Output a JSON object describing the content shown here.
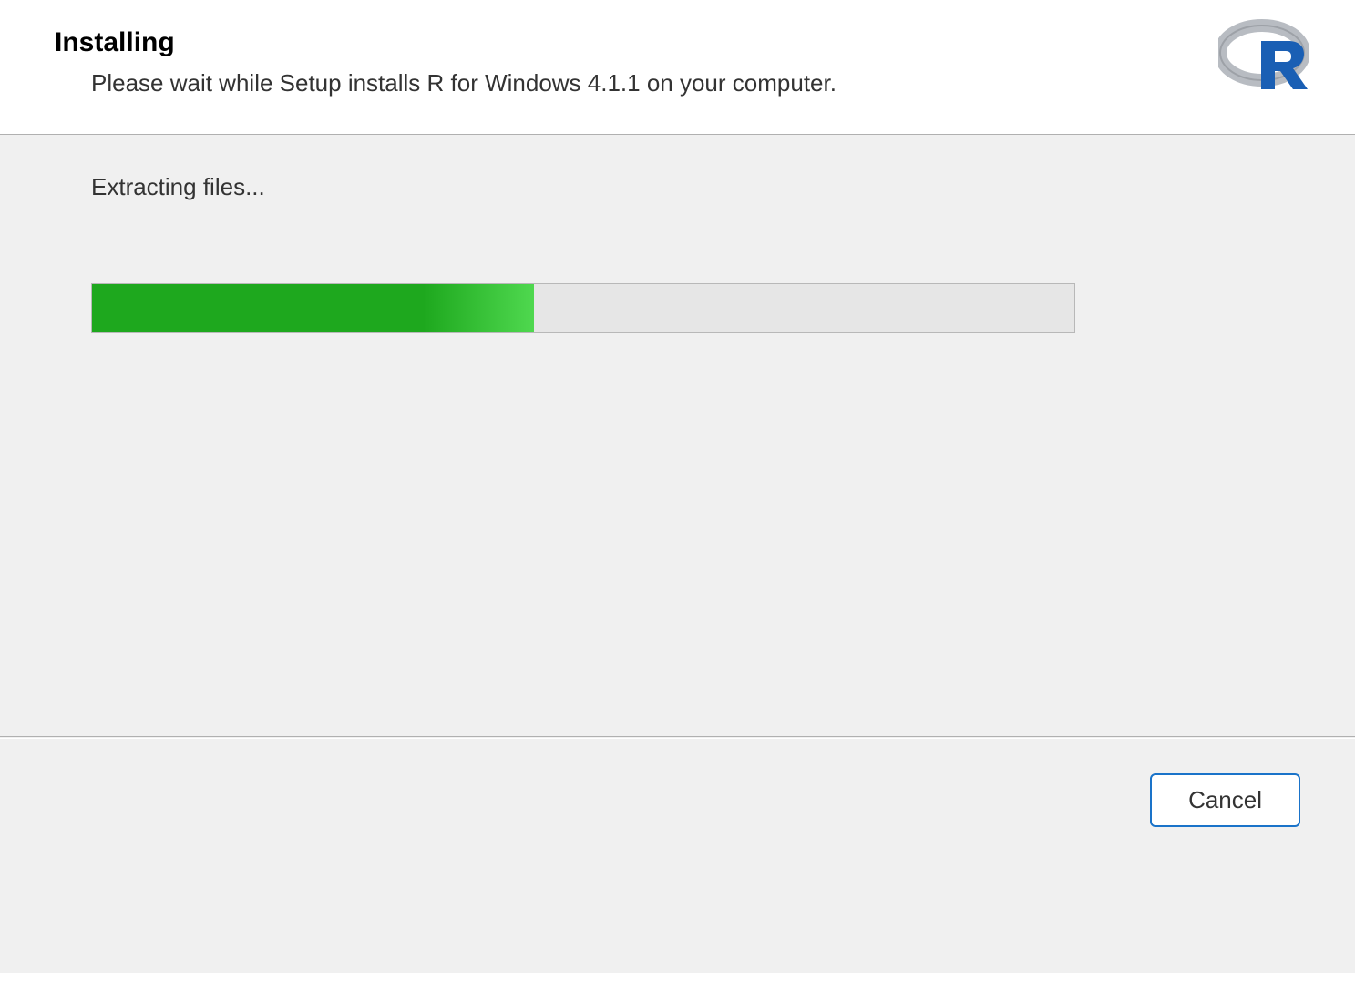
{
  "header": {
    "title": "Installing",
    "subtitle": "Please wait while Setup installs R for Windows 4.1.1 on your computer."
  },
  "content": {
    "status": "Extracting files...",
    "progress_percent": 45
  },
  "footer": {
    "cancel_label": "Cancel"
  },
  "logo": {
    "name": "R"
  }
}
